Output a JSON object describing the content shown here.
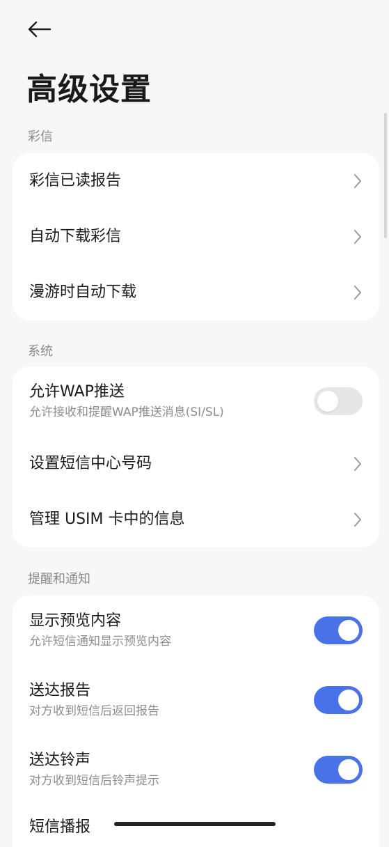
{
  "header": {
    "title": "高级设置"
  },
  "sections": {
    "mms": {
      "label": "彩信",
      "items": [
        "彩信已读报告",
        "自动下载彩信",
        "漫游时自动下载"
      ]
    },
    "system": {
      "label": "系统",
      "wap_title": "允许WAP推送",
      "wap_sub": "允许接收和提醒WAP推送消息(SI/SL)",
      "wap_on": false,
      "sms_center": "设置短信中心号码",
      "usim": "管理 USIM 卡中的信息"
    },
    "notify": {
      "label": "提醒和通知",
      "preview_title": "显示预览内容",
      "preview_sub": "允许短信通知显示预览内容",
      "preview_on": true,
      "delivery_title": "送达报告",
      "delivery_sub": "对方收到短信后返回报告",
      "delivery_on": true,
      "ringtone_title": "送达铃声",
      "ringtone_sub": "对方收到短信后铃声提示",
      "ringtone_on": true,
      "broadcast_title": "短信播报"
    }
  },
  "colors": {
    "toggle_on": "#4a72e8",
    "toggle_off": "#e6e6e6",
    "background": "#f7f7f7"
  },
  "icons": {
    "back": "arrow-left-icon",
    "chevron": "chevron-right-icon"
  }
}
